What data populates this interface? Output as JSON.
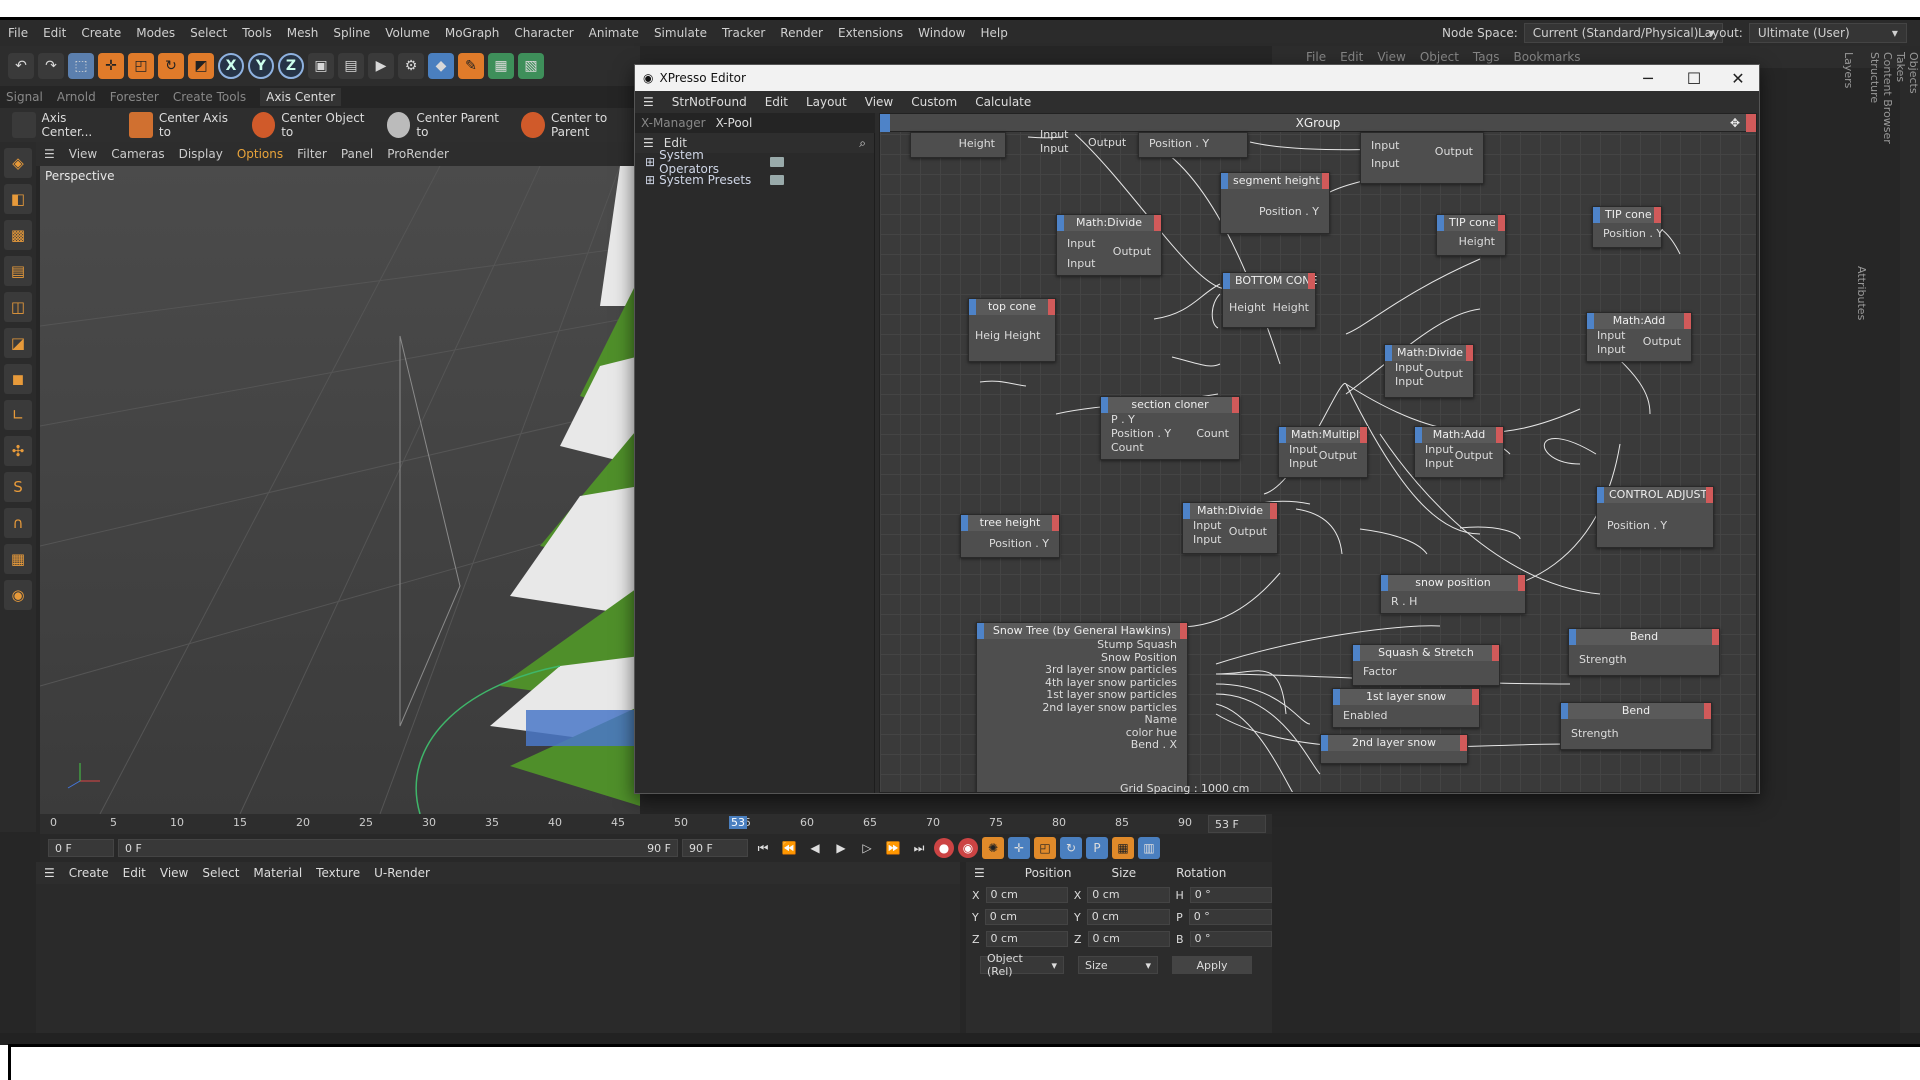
{
  "menubar": {
    "items": [
      "File",
      "Edit",
      "Create",
      "Modes",
      "Select",
      "Tools",
      "Mesh",
      "Spline",
      "Volume",
      "MoGraph",
      "Character",
      "Animate",
      "Simulate",
      "Tracker",
      "Render",
      "Extensions",
      "Window",
      "Help"
    ],
    "node_space_label": "Node Space:",
    "node_space_value": "Current (Standard/Physical)",
    "layout_label": "Layout:",
    "layout_value": "Ultimate (User)"
  },
  "toolbar": {
    "axis_x": "X",
    "axis_y": "Y",
    "axis_z": "Z"
  },
  "plugin_tabs": [
    "Signal",
    "Arnold",
    "Forester",
    "Create Tools",
    "Axis Center"
  ],
  "axis_bar": [
    "Axis Center...",
    "Center Axis to",
    "Center Object to",
    "Center Parent to",
    "Center to Parent"
  ],
  "viewport": {
    "menu": [
      "View",
      "Cameras",
      "Display",
      "Options",
      "Filter",
      "Panel",
      "ProRender"
    ],
    "label": "Perspective",
    "grid_spacing": "Grid Spacing : 1000 cm"
  },
  "xpresso": {
    "title": "XPresso Editor",
    "menu": [
      "StrNotFound",
      "Edit",
      "Layout",
      "View",
      "Custom",
      "Calculate"
    ],
    "tabs": [
      "X-Manager",
      "X-Pool"
    ],
    "pool_edit": "Edit",
    "pool_items": [
      "System Operators",
      "System Presets"
    ],
    "group_title": "XGroup",
    "nodes": {
      "n_top": {
        "in_height": "Height",
        "in1": "Input",
        "in2": "Input",
        "out": "Output",
        "pos": "Position . Y"
      },
      "n_topright": {
        "in1": "Input",
        "in2": "Input",
        "out": "Output"
      },
      "segment_height": {
        "title": "segment height",
        "p": "Position . Y"
      },
      "math_divide_1": {
        "title": "Math:Divide",
        "in1": "Input",
        "in2": "Input",
        "out": "Output"
      },
      "tip_cone": {
        "title": "TIP  cone",
        "p": "Height"
      },
      "tip_cone2": {
        "title": "TIP  cone",
        "p": "Position . Y"
      },
      "bottom_cone": {
        "title": "BOTTOM CONE",
        "in": "Height",
        "out": "Height"
      },
      "top_cone": {
        "title": "top cone",
        "in": "Heig",
        "out": "Height"
      },
      "math_add_1": {
        "title": "Math:Add",
        "in1": "Input",
        "in2": "Input",
        "out": "Output"
      },
      "math_divide_2": {
        "title": "Math:Divide",
        "in1": "Input",
        "in2": "Input",
        "out": "Output"
      },
      "section_cloner": {
        "title": "section cloner",
        "p1": "P . Y",
        "p2": "Position . Y",
        "p3": "Count",
        "out": "Count"
      },
      "math_multiply": {
        "title": "Math:Multiply",
        "in1": "Input",
        "in2": "Input",
        "out": "Output"
      },
      "math_add_2": {
        "title": "Math:Add",
        "in1": "Input",
        "in2": "Input",
        "out": "Output"
      },
      "control_adjust": {
        "title": "CONTROL ADJUST",
        "p": "Position . Y"
      },
      "tree_height": {
        "title": "tree height",
        "p": "Position . Y"
      },
      "math_divide_3": {
        "title": "Math:Divide",
        "in1": "Input",
        "in2": "Input",
        "out": "Output"
      },
      "snow_position": {
        "title": "snow position",
        "p": "R . H"
      },
      "snow_tree": {
        "title": "Snow Tree (by General Hawkins)",
        "ports": [
          "Stump Squash",
          "Snow Position",
          "3rd layer snow particles",
          "4th layer snow particles",
          "1st layer snow particles",
          "2nd layer snow particles",
          "Name",
          "color hue",
          "Bend . X"
        ]
      },
      "squash_stretch": {
        "title": "Squash & Stretch",
        "p": "Factor"
      },
      "bend_1": {
        "title": "Bend",
        "p": "Strength"
      },
      "layer1_snow": {
        "title": "1st layer snow",
        "p": "Enabled"
      },
      "bend_2": {
        "title": "Bend",
        "p": "Strength"
      },
      "layer2_snow": {
        "title": "2nd layer snow"
      }
    }
  },
  "timeline": {
    "ticks": [
      "0",
      "5",
      "10",
      "15",
      "20",
      "25",
      "30",
      "35",
      "40",
      "45",
      "50",
      "55",
      "60",
      "65",
      "70",
      "75",
      "80",
      "85",
      "90"
    ],
    "current": "53",
    "frame_field": "53 F",
    "start": "0 F",
    "range_start": "0 F",
    "range_end": "90 F",
    "end": "90 F"
  },
  "material_menu": [
    "Create",
    "Edit",
    "View",
    "Select",
    "Material",
    "Texture",
    "U-Render"
  ],
  "coords": {
    "headers": [
      "Position",
      "Size",
      "Rotation"
    ],
    "rows": [
      {
        "a": "X",
        "pv": "0 cm",
        "b": "X",
        "sv": "0 cm",
        "c": "H",
        "rv": "0 °"
      },
      {
        "a": "Y",
        "pv": "0 cm",
        "b": "Y",
        "sv": "0 cm",
        "c": "P",
        "rv": "0 °"
      },
      {
        "a": "Z",
        "pv": "0 cm",
        "b": "Z",
        "sv": "0 cm",
        "c": "B",
        "rv": "0 °"
      }
    ],
    "mode": "Object (Rel)",
    "size_mode": "Size",
    "apply": "Apply"
  },
  "object_manager_menu": [
    "File",
    "Edit",
    "View",
    "Object",
    "Tags",
    "Bookmarks"
  ],
  "side_tabs": [
    "Objects",
    "Takes",
    "Content Browser",
    "Structure",
    "Attributes",
    "Layers"
  ],
  "colors": {
    "accent_orange": "#e07b2a",
    "node_blue": "#4e83c8",
    "node_red": "#d15a5a",
    "tree_green": "#4f8f2a"
  }
}
